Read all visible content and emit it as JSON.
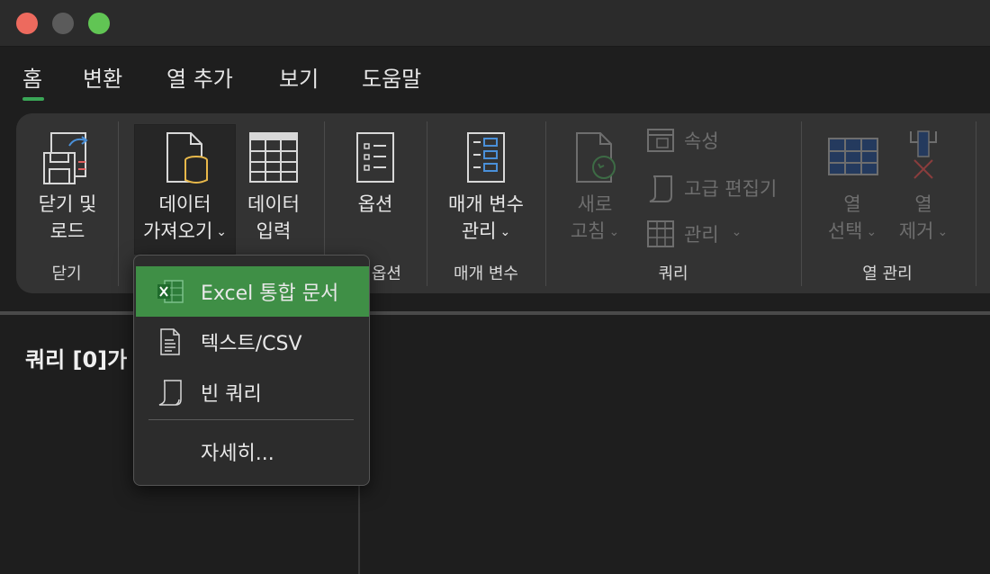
{
  "window": {
    "title": ""
  },
  "tabs": [
    {
      "label": "홈",
      "active": true
    },
    {
      "label": "변환"
    },
    {
      "label": "열 추가"
    },
    {
      "label": "보기"
    },
    {
      "label": "도움말"
    }
  ],
  "ribbon": {
    "close_load": {
      "line1": "닫기 및",
      "line2": "로드",
      "group": "닫기"
    },
    "get_data": {
      "line1": "데이터",
      "line2": "가져오기"
    },
    "enter_data": {
      "line1": "데이터",
      "line2": "입력"
    },
    "options": {
      "label": "옵션",
      "group": "옵션"
    },
    "params": {
      "line1": "매개 변수",
      "line2": "관리",
      "group": "매개 변수"
    },
    "query": {
      "refresh_line1": "새로",
      "refresh_line2": "고침",
      "properties": "속성",
      "advanced_editor": "고급 편집기",
      "manage": "관리",
      "group": "쿼리"
    },
    "columns": {
      "select_line1": "열",
      "select_line2": "선택",
      "remove_line1": "열",
      "remove_line2": "제거",
      "group": "열 관리"
    }
  },
  "pane": {
    "title": "쿼리 [0]가"
  },
  "menu": {
    "items": [
      {
        "label": "Excel 통합 문서",
        "icon": "excel-icon",
        "selected": true
      },
      {
        "label": "텍스트/CSV",
        "icon": "text-file-icon"
      },
      {
        "label": "빈 쿼리",
        "icon": "blank-query-icon"
      },
      {
        "label": "자세히..."
      }
    ]
  },
  "colors": {
    "accent": "#3f8f46",
    "underline": "#3aa657",
    "icon_blue": "#4a90d9",
    "icon_yellow": "#e8b84a"
  }
}
